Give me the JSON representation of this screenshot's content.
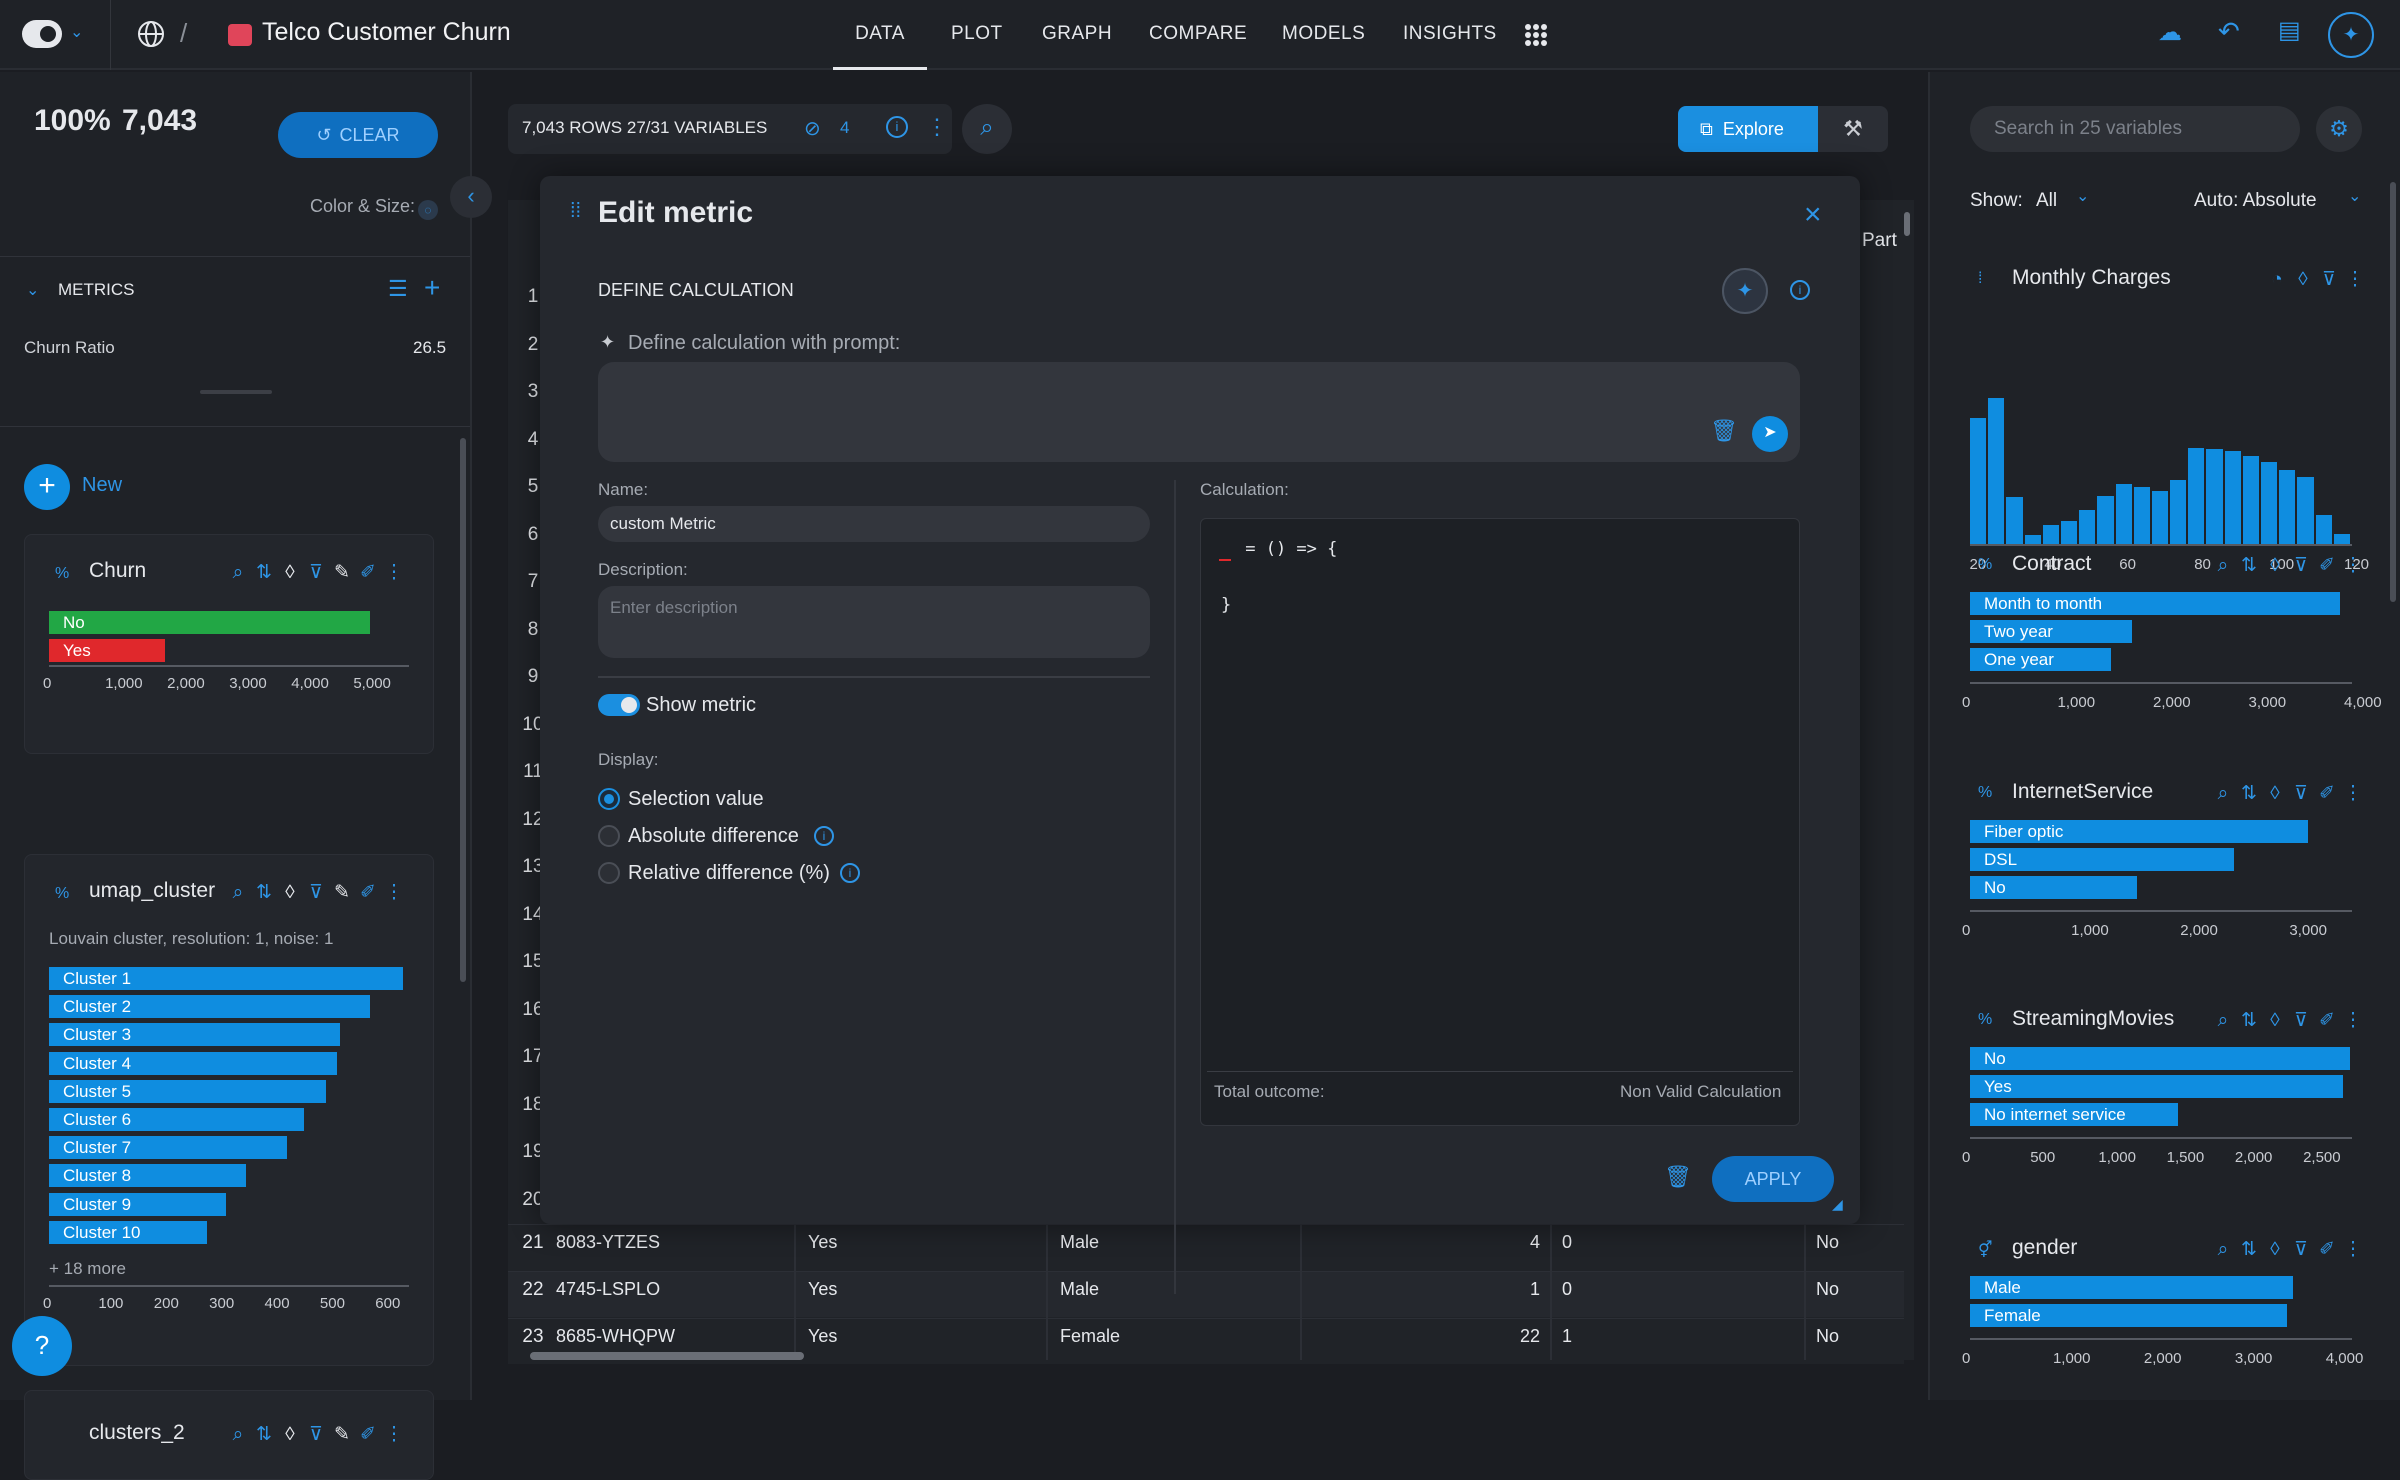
{
  "app": {
    "title": "Telco Customer Churn"
  },
  "nav": {
    "tabs": [
      "DATA",
      "PLOT",
      "GRAPH",
      "COMPARE",
      "MODELS",
      "INSIGHTS"
    ],
    "active": "DATA"
  },
  "left": {
    "percent": "100%",
    "count": "7,043",
    "clear_label": "CLEAR",
    "color_size_label": "Color & Size:",
    "metrics_header": "METRICS",
    "metric_name": "Churn Ratio",
    "metric_value": "26.5",
    "new_label": "New",
    "churn": {
      "title": "Churn",
      "bars": [
        {
          "label": "No",
          "value": 5174,
          "color": "#22a745"
        },
        {
          "label": "Yes",
          "value": 1869,
          "color": "#e0282c"
        }
      ],
      "ticks": [
        "0",
        "1,000",
        "2,000",
        "3,000",
        "4,000",
        "5,000"
      ]
    },
    "umap": {
      "title": "umap_cluster",
      "subtitle": "Louvain cluster, resolution: 1, noise: 1",
      "bars": [
        {
          "label": "Cluster 1",
          "value": 640
        },
        {
          "label": "Cluster 2",
          "value": 580
        },
        {
          "label": "Cluster 3",
          "value": 525
        },
        {
          "label": "Cluster 4",
          "value": 520
        },
        {
          "label": "Cluster 5",
          "value": 500
        },
        {
          "label": "Cluster 6",
          "value": 460
        },
        {
          "label": "Cluster 7",
          "value": 430
        },
        {
          "label": "Cluster 8",
          "value": 355
        },
        {
          "label": "Cluster 9",
          "value": 320
        },
        {
          "label": "Cluster 10",
          "value": 285
        }
      ],
      "more": "+ 18 more",
      "ticks": [
        "0",
        "100",
        "200",
        "300",
        "400",
        "500",
        "600"
      ]
    },
    "clusters2_title": "clusters_2",
    "help": "?"
  },
  "table": {
    "summary": "7,043 ROWS 27/31 VARIABLES",
    "hidden_count": "4",
    "explore_label": "Explore",
    "partial_header": "Part",
    "row_numbers": [
      "1",
      "2",
      "3",
      "4",
      "5",
      "6",
      "7",
      "8",
      "9",
      "10",
      "11",
      "12",
      "13",
      "14",
      "15",
      "16",
      "17",
      "18",
      "19",
      "20"
    ],
    "rows": [
      {
        "num": "21",
        "id": "8083-YTZES",
        "churn": "Yes",
        "gender": "Male",
        "tenure": "4",
        "senior": "0",
        "last": "No"
      },
      {
        "num": "22",
        "id": "4745-LSPLO",
        "churn": "Yes",
        "gender": "Male",
        "tenure": "1",
        "senior": "0",
        "last": "No"
      },
      {
        "num": "23",
        "id": "8685-WHQPW",
        "churn": "Yes",
        "gender": "Female",
        "tenure": "22",
        "senior": "1",
        "last": "No"
      }
    ]
  },
  "modal": {
    "title": "Edit metric",
    "section": "DEFINE CALCULATION",
    "prompt_label": "Define calculation with prompt:",
    "name_label": "Name:",
    "name_value": "custom Metric",
    "description_label": "Description:",
    "description_placeholder": "Enter description",
    "show_metric_label": "Show metric",
    "display_label": "Display:",
    "options": [
      "Selection value",
      "Absolute difference",
      "Relative difference (%)"
    ],
    "calc_label": "Calculation:",
    "code_line1": " = () => {",
    "code_line2": "}",
    "total_label": "Total outcome:",
    "total_value": "Non Valid Calculation",
    "apply_label": "APPLY"
  },
  "right": {
    "search_placeholder": "Search in 25 variables",
    "show_label": "Show:",
    "show_value": "All",
    "auto_value": "Auto: Absolute",
    "monthly": {
      "title": "Monthly Charges",
      "hist": [
        0.86,
        1.0,
        0.32,
        0.06,
        0.13,
        0.16,
        0.23,
        0.33,
        0.41,
        0.39,
        0.36,
        0.44,
        0.66,
        0.65,
        0.64,
        0.6,
        0.56,
        0.51,
        0.46,
        0.2,
        0.07
      ],
      "ticks": [
        "20",
        "40",
        "60",
        "80",
        "100",
        "120"
      ]
    },
    "contract": {
      "title": "Contract",
      "max": 4000,
      "bars": [
        {
          "label": "Month to month",
          "value": 3875
        },
        {
          "label": "Two year",
          "value": 1695
        },
        {
          "label": "One year",
          "value": 1473
        }
      ],
      "ticks": [
        "0",
        "1,000",
        "2,000",
        "3,000",
        "4,000"
      ]
    },
    "internet": {
      "title": "InternetService",
      "max": 3500,
      "bars": [
        {
          "label": "Fiber optic",
          "value": 3096
        },
        {
          "label": "DSL",
          "value": 2421
        },
        {
          "label": "No",
          "value": 1526
        }
      ],
      "ticks": [
        "0",
        "1,000",
        "2,000",
        "3,000"
      ]
    },
    "streaming": {
      "title": "StreamingMovies",
      "max": 2800,
      "bars": [
        {
          "label": "No",
          "value": 2785
        },
        {
          "label": "Yes",
          "value": 2732
        },
        {
          "label": "No internet service",
          "value": 1526
        }
      ],
      "ticks": [
        "0",
        "500",
        "1,000",
        "1,500",
        "2,000",
        "2,500"
      ]
    },
    "gender": {
      "title": "gender",
      "max": 4200,
      "bars": [
        {
          "label": "Male",
          "value": 3555
        },
        {
          "label": "Female",
          "value": 3488
        }
      ],
      "ticks": [
        "0",
        "1,000",
        "2,000",
        "3,000",
        "4,000"
      ]
    }
  }
}
